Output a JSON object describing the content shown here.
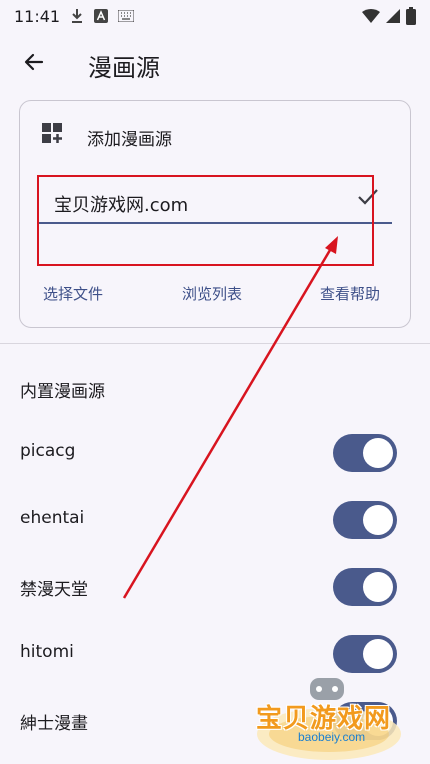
{
  "status_bar": {
    "time": "11:41",
    "left_icons": [
      "download-icon",
      "a-notification-icon",
      "keyboard-icon"
    ],
    "right_icons": [
      "wifi-icon",
      "cellular-icon",
      "battery-icon"
    ]
  },
  "app_bar": {
    "title": "漫画源",
    "back_icon": "arrow-back-icon"
  },
  "add_card": {
    "title": "添加漫画源",
    "icon": "dashboard-add-icon",
    "input_value": "宝贝游戏网.com",
    "confirm_icon": "check-icon",
    "actions": [
      "选择文件",
      "浏览列表",
      "查看帮助"
    ]
  },
  "builtin": {
    "title": "内置漫画源",
    "items": [
      {
        "label": "picacg",
        "enabled": true
      },
      {
        "label": "ehentai",
        "enabled": true
      },
      {
        "label": "禁漫天堂",
        "enabled": true
      },
      {
        "label": "hitomi",
        "enabled": true
      },
      {
        "label": "紳士漫畫",
        "enabled": true
      }
    ]
  },
  "watermark": {
    "text": "宝贝游戏网",
    "url": "baobeiy.com"
  },
  "colors": {
    "accent": "#4a5a8c",
    "link": "#3e5089",
    "annotation": "#d8141f",
    "background": "#f7f5fb"
  }
}
